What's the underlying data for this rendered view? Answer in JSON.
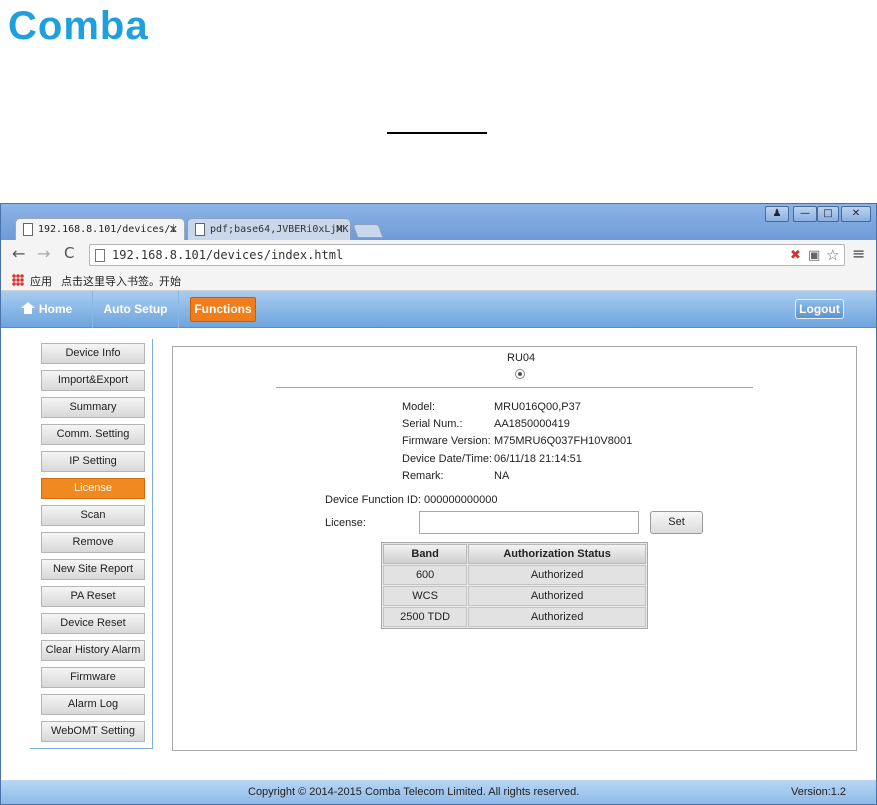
{
  "document": {
    "logo_text": "Comba",
    "brand_color": "#1ea0df"
  },
  "browser": {
    "tabs": [
      {
        "label": "192.168.8.101/devices/i",
        "active": true
      },
      {
        "label": "pdf;base64,JVBERi0xLjMK",
        "active": false
      }
    ],
    "window_controls": {
      "user": "♟",
      "minimize": "—",
      "maximize": "□",
      "close": "✕"
    },
    "nav": {
      "back": "←",
      "forward": "→",
      "reload": "C"
    },
    "url": "192.168.8.101/devices/index.html",
    "bookmarks": {
      "apps_label": "应用",
      "import_label": "点击这里导入书签。",
      "start_label": "开始"
    }
  },
  "app": {
    "nav": {
      "home": "Home",
      "auto_setup": "Auto Setup",
      "functions": "Functions",
      "logout": "Logout"
    },
    "accent_color": "#f08a20",
    "sidebar": [
      {
        "label": "Device Info",
        "active": false
      },
      {
        "label": "Import&Export",
        "active": false
      },
      {
        "label": "Summary",
        "active": false
      },
      {
        "label": "Comm. Setting",
        "active": false
      },
      {
        "label": "IP Setting",
        "active": false
      },
      {
        "label": "License",
        "active": true
      },
      {
        "label": "Scan",
        "active": false
      },
      {
        "label": "Remove",
        "active": false
      },
      {
        "label": "New Site Report",
        "active": false
      },
      {
        "label": "PA Reset",
        "active": false
      },
      {
        "label": "Device Reset",
        "active": false
      },
      {
        "label": "Clear History Alarm",
        "active": false
      },
      {
        "label": "Firmware",
        "active": false
      },
      {
        "label": "Alarm Log",
        "active": false
      },
      {
        "label": "WebOMT Setting",
        "active": false
      }
    ],
    "device": {
      "ru_label": "RU04",
      "info": [
        {
          "key": "Model:",
          "value": "MRU016Q00,P37"
        },
        {
          "key": "Serial Num.:",
          "value": "AA1850000419"
        },
        {
          "key": "Firmware Version:",
          "value": "M75MRU6Q037FH10V8001"
        },
        {
          "key": "Device Date/Time:",
          "value": "06/11/18 21:14:51"
        },
        {
          "key": "Remark:",
          "value": "NA"
        }
      ],
      "function_id": "Device Function ID: 000000000000",
      "license_label": "License:",
      "license_value": "",
      "set_label": "Set"
    },
    "auth_table": {
      "headers": [
        "Band",
        "Authorization Status"
      ],
      "rows": [
        [
          "600",
          "Authorized"
        ],
        [
          "WCS",
          "Authorized"
        ],
        [
          "2500 TDD",
          "Authorized"
        ]
      ]
    },
    "footer": {
      "copyright": "Copyright © 2014-2015 Comba Telecom Limited. All rights reserved.",
      "version": "Version:1.2"
    }
  }
}
